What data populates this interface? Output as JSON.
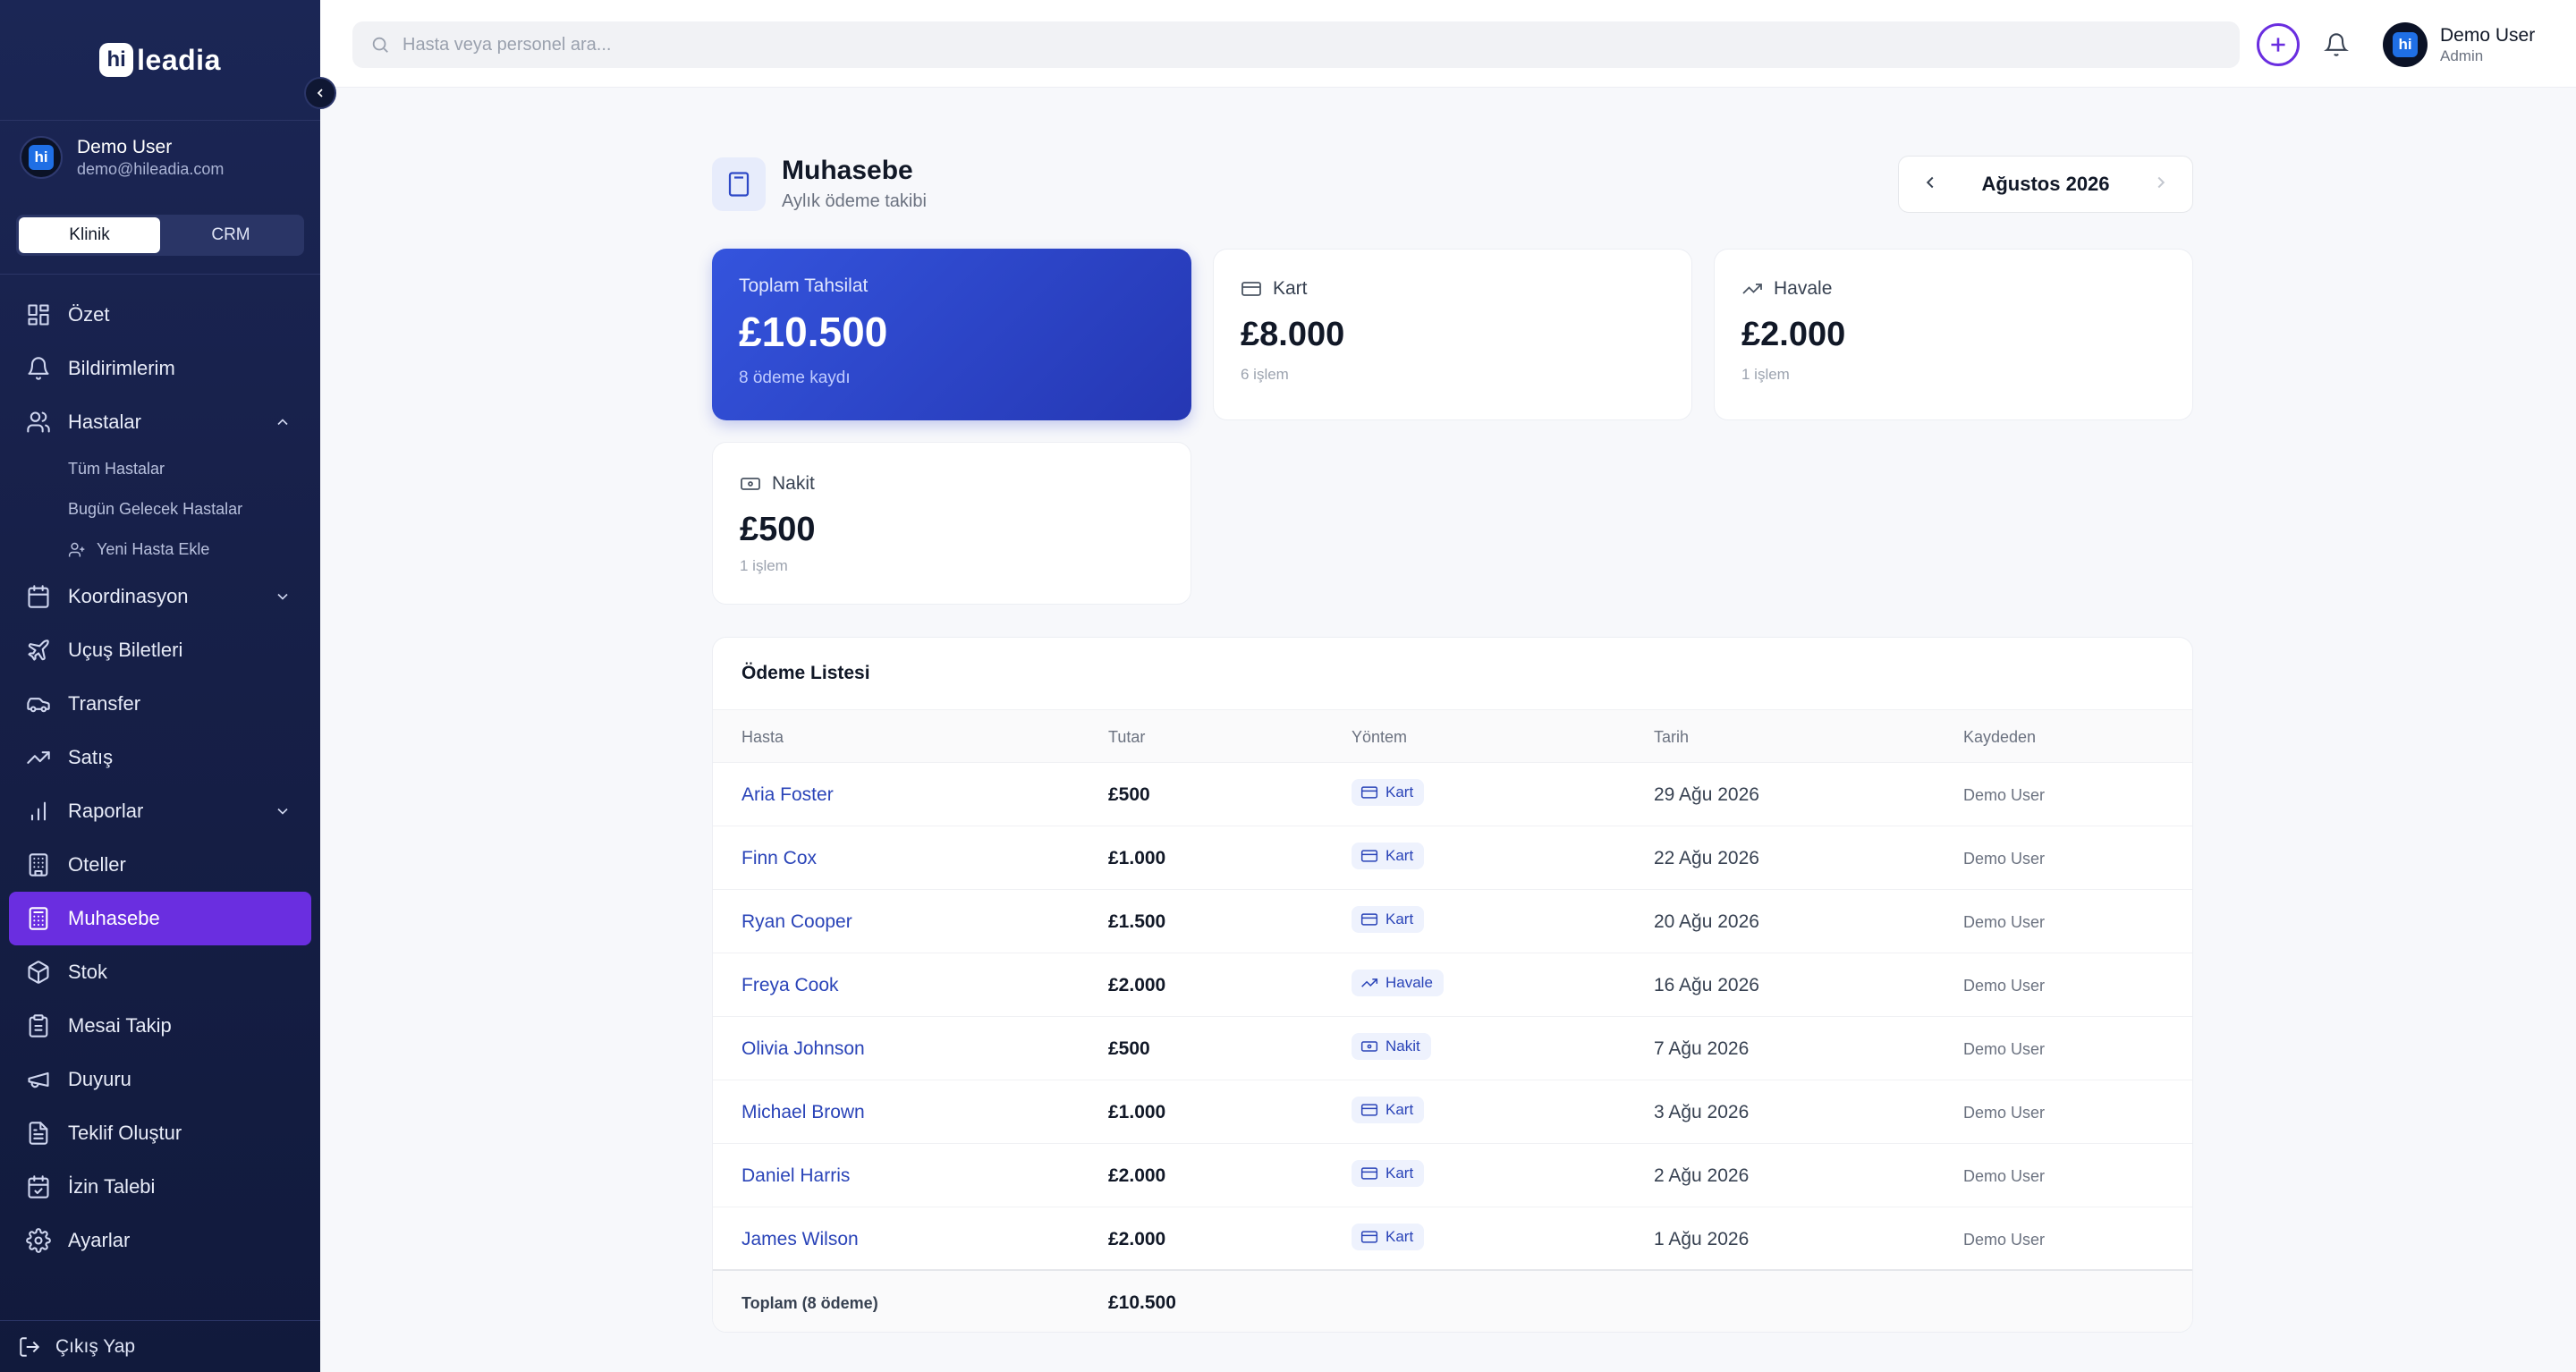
{
  "brand": {
    "logo_badge": "hi",
    "logo_text": "leadia"
  },
  "sidebar": {
    "user": {
      "name": "Demo User",
      "email": "demo@hileadia.com"
    },
    "modes": [
      "Klinik",
      "CRM"
    ],
    "active_mode": "Klinik",
    "items": {
      "ozet": "Özet",
      "bildirimler": "Bildirimlerim",
      "hastalar": "Hastalar",
      "koordinasyon": "Koordinasyon",
      "ucus": "Uçuş Biletleri",
      "transfer": "Transfer",
      "satis": "Satış",
      "raporlar": "Raporlar",
      "oteller": "Oteller",
      "muhasebe": "Muhasebe",
      "stok": "Stok",
      "mesai": "Mesai Takip",
      "duyuru": "Duyuru",
      "teklif": "Teklif Oluştur",
      "izin": "İzin Talebi",
      "ayarlar": "Ayarlar"
    },
    "hastalar_sub": {
      "tum": "Tüm Hastalar",
      "bugun": "Bugün Gelecek Hastalar",
      "yeni": "Yeni Hasta Ekle"
    },
    "logout": "Çıkış Yap"
  },
  "topbar": {
    "search_placeholder": "Hasta veya personel ara...",
    "user": {
      "name": "Demo User",
      "role": "Admin"
    }
  },
  "page": {
    "title": "Muhasebe",
    "subtitle": "Aylık ödeme takibi",
    "month": "Ağustos 2026"
  },
  "summary": {
    "total": {
      "label": "Toplam Tahsilat",
      "value": "£10.500",
      "sub": "8 ödeme kaydı"
    },
    "card": {
      "label": "Kart",
      "value": "£8.000",
      "sub": "6 işlem"
    },
    "transfer": {
      "label": "Havale",
      "value": "£2.000",
      "sub": "1 işlem"
    },
    "cash": {
      "label": "Nakit",
      "value": "£500",
      "sub": "1 işlem"
    }
  },
  "table": {
    "title": "Ödeme Listesi",
    "headers": {
      "patient": "Hasta",
      "amount": "Tutar",
      "method": "Yöntem",
      "date": "Tarih",
      "by": "Kaydeden"
    },
    "rows": [
      {
        "patient": "Aria Foster",
        "amount": "£500",
        "method": "Kart",
        "date": "29 Ağu 2026",
        "by": "Demo User"
      },
      {
        "patient": "Finn Cox",
        "amount": "£1.000",
        "method": "Kart",
        "date": "22 Ağu 2026",
        "by": "Demo User"
      },
      {
        "patient": "Ryan Cooper",
        "amount": "£1.500",
        "method": "Kart",
        "date": "20 Ağu 2026",
        "by": "Demo User"
      },
      {
        "patient": "Freya Cook",
        "amount": "£2.000",
        "method": "Havale",
        "date": "16 Ağu 2026",
        "by": "Demo User"
      },
      {
        "patient": "Olivia Johnson",
        "amount": "£500",
        "method": "Nakit",
        "date": "7 Ağu 2026",
        "by": "Demo User"
      },
      {
        "patient": "Michael Brown",
        "amount": "£1.000",
        "method": "Kart",
        "date": "3 Ağu 2026",
        "by": "Demo User"
      },
      {
        "patient": "Daniel Harris",
        "amount": "£2.000",
        "method": "Kart",
        "date": "2 Ağu 2026",
        "by": "Demo User"
      },
      {
        "patient": "James Wilson",
        "amount": "£2.000",
        "method": "Kart",
        "date": "1 Ağu 2026",
        "by": "Demo User"
      }
    ],
    "footer": {
      "label": "Toplam (8 ödeme)",
      "value": "£10.500"
    }
  },
  "colors": {
    "sidebar_bg": "#1b2655",
    "accent": "#6a2ee0",
    "primary_card": "#3454dd",
    "link": "#2a44b8"
  }
}
